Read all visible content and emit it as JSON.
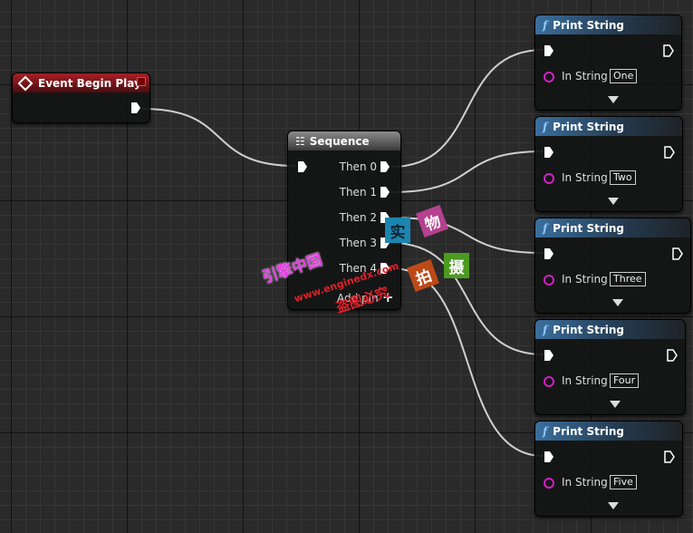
{
  "event_node": {
    "title": "Event Begin Play",
    "icon": "event-diamond-icon"
  },
  "sequence_node": {
    "title": "Sequence",
    "icon": "sequence-icon",
    "outputs": [
      "Then 0",
      "Then 1",
      "Then 2",
      "Then 3",
      "Then 4"
    ],
    "add_pin": "Add pin"
  },
  "print_nodes": [
    {
      "title": "Print String",
      "pin_label": "In String",
      "value": "One"
    },
    {
      "title": "Print String",
      "pin_label": "In String",
      "value": "Two"
    },
    {
      "title": "Print String",
      "pin_label": "In String",
      "value": "Three"
    },
    {
      "title": "Print String",
      "pin_label": "In String",
      "value": "Four"
    },
    {
      "title": "Print String",
      "pin_label": "In String",
      "value": "Five"
    }
  ],
  "function_icon": "f",
  "watermark": {
    "site": "引擎中国",
    "url": "www.enginedx.com",
    "notice": "盗图必究",
    "stamps": [
      "实",
      "物",
      "拍",
      "摄"
    ]
  },
  "colors": {
    "event": "#a81f24",
    "string_pin": "#d21fc6",
    "wire": "#cfcfcf"
  }
}
